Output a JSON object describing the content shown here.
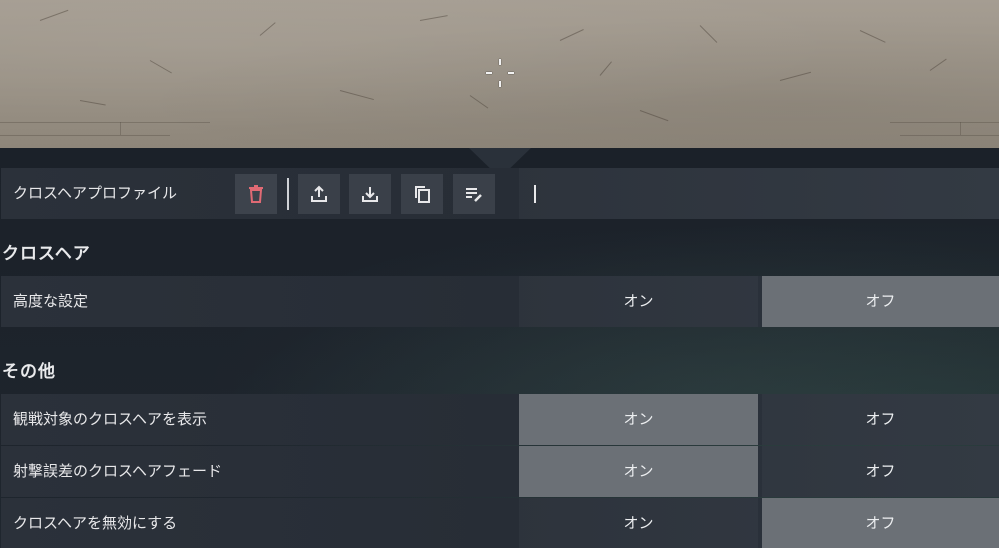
{
  "preview": {
    "crosshair_icon": "crosshair-icon"
  },
  "profile": {
    "label": "クロスヘアプロファイル",
    "buttons": [
      {
        "name": "delete",
        "icon": "trash-icon",
        "color": "#e06a74"
      },
      {
        "name": "export",
        "icon": "upload-icon"
      },
      {
        "name": "import",
        "icon": "download-icon"
      },
      {
        "name": "copy",
        "icon": "copy-icon"
      },
      {
        "name": "rename",
        "icon": "edit-list-icon"
      }
    ],
    "input_value": ""
  },
  "sections": {
    "crosshair": {
      "title": "クロスヘア",
      "rows": [
        {
          "label": "高度な設定",
          "on": "オン",
          "off": "オフ",
          "selected": "off"
        }
      ]
    },
    "other": {
      "title": "その他",
      "rows": [
        {
          "label": "観戦対象のクロスヘアを表示",
          "on": "オン",
          "off": "オフ",
          "selected": "on"
        },
        {
          "label": "射撃誤差のクロスヘアフェード",
          "on": "オン",
          "off": "オフ",
          "selected": "on"
        },
        {
          "label": "クロスヘアを無効にする",
          "on": "オン",
          "off": "オフ",
          "selected": "off"
        }
      ]
    }
  },
  "colors": {
    "selected_toggle": "#6b7076",
    "delete_accent": "#e06a74",
    "panel_bg": "#1d232b"
  }
}
